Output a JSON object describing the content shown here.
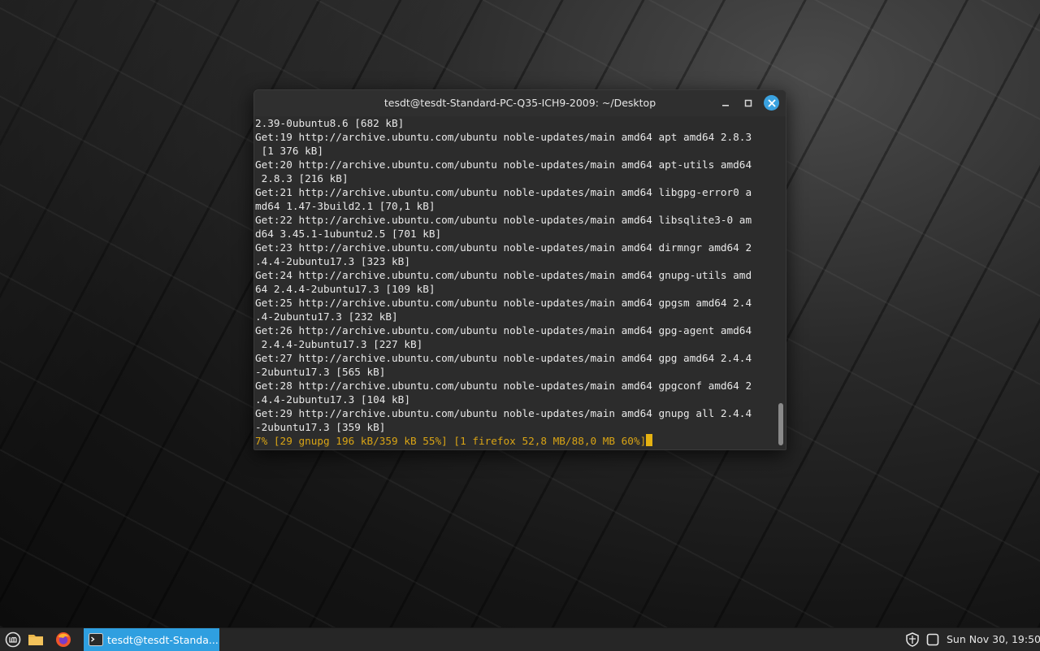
{
  "window": {
    "title": "tesdt@tesdt-Standard-PC-Q35-ICH9-2009: ~/Desktop"
  },
  "terminal": {
    "lines": [
      "2.39-0ubuntu8.6 [682 kB]",
      "Get:19 http://archive.ubuntu.com/ubuntu noble-updates/main amd64 apt amd64 2.8.3",
      " [1 376 kB]",
      "Get:20 http://archive.ubuntu.com/ubuntu noble-updates/main amd64 apt-utils amd64",
      " 2.8.3 [216 kB]",
      "Get:21 http://archive.ubuntu.com/ubuntu noble-updates/main amd64 libgpg-error0 a",
      "md64 1.47-3build2.1 [70,1 kB]",
      "Get:22 http://archive.ubuntu.com/ubuntu noble-updates/main amd64 libsqlite3-0 am",
      "d64 3.45.1-1ubuntu2.5 [701 kB]",
      "Get:23 http://archive.ubuntu.com/ubuntu noble-updates/main amd64 dirmngr amd64 2",
      ".4.4-2ubuntu17.3 [323 kB]",
      "Get:24 http://archive.ubuntu.com/ubuntu noble-updates/main amd64 gnupg-utils amd",
      "64 2.4.4-2ubuntu17.3 [109 kB]",
      "Get:25 http://archive.ubuntu.com/ubuntu noble-updates/main amd64 gpgsm amd64 2.4",
      ".4-2ubuntu17.3 [232 kB]",
      "Get:26 http://archive.ubuntu.com/ubuntu noble-updates/main amd64 gpg-agent amd64",
      " 2.4.4-2ubuntu17.3 [227 kB]",
      "Get:27 http://archive.ubuntu.com/ubuntu noble-updates/main amd64 gpg amd64 2.4.4",
      "-2ubuntu17.3 [565 kB]",
      "Get:28 http://archive.ubuntu.com/ubuntu noble-updates/main amd64 gpgconf amd64 2",
      ".4.4-2ubuntu17.3 [104 kB]",
      "Get:29 http://archive.ubuntu.com/ubuntu noble-updates/main amd64 gnupg all 2.4.4",
      "-2ubuntu17.3 [359 kB]"
    ],
    "progress_line": "7% [29 gnupg 196 kB/359 kB 55%] [1 firefox 52,8 MB/88,0 MB 60%]",
    "text_color": "#e8e8e8",
    "progress_color": "#d9a415",
    "background_color": "#2c2c2c"
  },
  "taskbar": {
    "terminal_task_label": "tesdt@tesdt-Standa...",
    "clock": "Sun Nov 30, 19:50",
    "accent_color": "#2f9fe0",
    "icons": {
      "menu": "mint-menu-icon",
      "files": "folder-icon",
      "firefox": "firefox-icon",
      "terminal": "terminal-icon",
      "shield": "shield-icon",
      "notifications": "notifications-icon"
    }
  }
}
